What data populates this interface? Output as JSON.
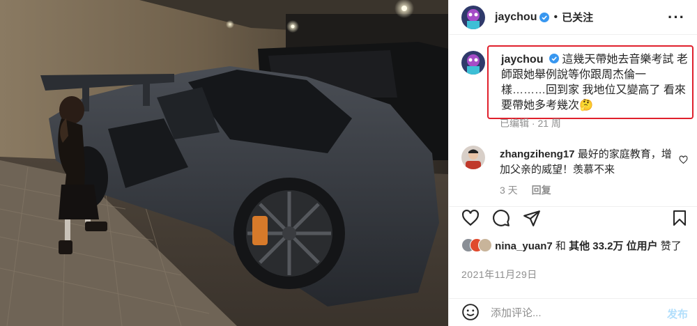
{
  "post": {
    "username": "jaychou",
    "follow_separator": "•",
    "follow_state": "已关注",
    "more_label": "···"
  },
  "caption": {
    "username": "jaychou",
    "text": "這幾天帶她去音樂考試 老師跟她舉例說等你跟周杰倫一樣………回到家 我地位又變高了 看來要帶她多考幾次🤔",
    "edited": "已编辑",
    "meta_separator": "·",
    "age": "21 周"
  },
  "comment": {
    "username": "zhangziheng17",
    "text": "最好的家庭教育，增加父亲的威望！羡慕不来",
    "age": "3 天",
    "reply_label": "回复"
  },
  "likes": {
    "liker": "nina_yuan7",
    "connector": "和",
    "others": "其他 33.2万 位用户",
    "suffix": "赞了"
  },
  "date": "2021年11月29日",
  "comment_box": {
    "placeholder": "添加评论...",
    "post_label": "发布"
  },
  "icons": {
    "like": "heart-icon",
    "comment": "comment-icon",
    "share": "paper-plane-icon",
    "save": "bookmark-icon",
    "emoji": "emoji-icon",
    "more": "more-dots-icon",
    "verified": "verified-badge-icon"
  },
  "colors": {
    "highlight_border": "#e0202c",
    "verified_blue": "#3897f0",
    "muted_text": "#8e8e8e",
    "post_button": "#b2dffc"
  }
}
